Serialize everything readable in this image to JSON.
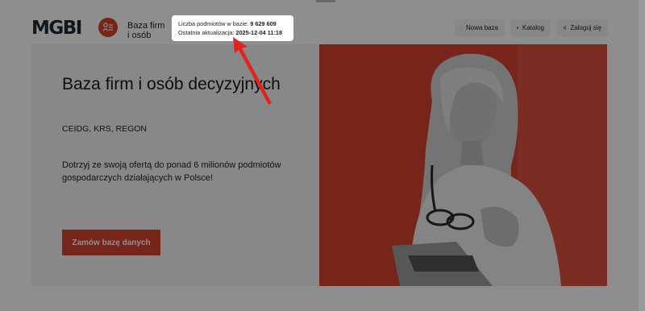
{
  "header": {
    "logo": "MGBI",
    "logo_subtitle_line1": "Baza firm",
    "logo_subtitle_line2": "i osób",
    "stats": {
      "count_label": "Liczba podmiotów w bazie:",
      "count_value": "9 629 609",
      "updated_label": "Ostatnia aktualizacja:",
      "updated_value": "2025-12-04 11:18"
    },
    "buttons": {
      "new_base": "Nowa baza",
      "catalog": "Katalog",
      "login": "Zaloguj się"
    }
  },
  "hero": {
    "title": "Baza firm i osób decyzyjnych",
    "subtitle": "CEIDG, KRS, REGON",
    "description": "Dotrzyj ze swoją ofertą do ponad 6 milionów podmiotów gospodarczych działających w Polsce!",
    "cta": "Zamów bazę danych"
  },
  "colors": {
    "brand_red": "#d4412f",
    "logo_dark": "#1e2a35",
    "annotation_arrow": "#e0231f"
  },
  "icons": [
    "plus-icon",
    "book-icon",
    "login-icon",
    "contacts-icon"
  ]
}
